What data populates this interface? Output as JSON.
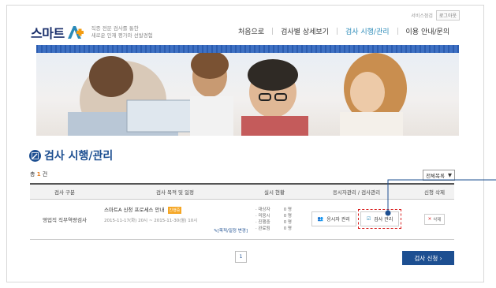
{
  "util": {
    "sitemap": "서비스점검",
    "logout": "로그아웃"
  },
  "logo": {
    "text": "스마트",
    "desc_line1": "직종 전문 검사를 통한",
    "desc_line2": "새로운 인재 평가와 선발경험"
  },
  "gnb": [
    {
      "label": "처음으로"
    },
    {
      "label": "검사별 상세보기"
    },
    {
      "label": "검사 시행/관리"
    },
    {
      "label": "이용 안내/문의"
    }
  ],
  "page": {
    "title": "검사 시행/관리",
    "total_prefix": "총",
    "total_count": "1",
    "total_suffix": "건",
    "filter": "전체목록"
  },
  "table": {
    "headers": [
      "검사 구분",
      "검사 목적 및 일정",
      "실시 현황",
      "응시자관리 / 검사관리",
      "신청 삭제"
    ],
    "row": {
      "category": "영업직 직무역량검사",
      "name": "스마트A 신청 프로세스 안내",
      "badge": "진행중",
      "period": "2015-11-17(화) 20시 ~ 2015-11-30(월) 10시",
      "edit": "[목적/일정 변경]",
      "status": [
        {
          "label": "· 대상자",
          "value": "0 명"
        },
        {
          "label": "· 미응시",
          "value": "0 명"
        },
        {
          "label": "· 진행중",
          "value": "0 명"
        },
        {
          "label": "· 완료됨",
          "value": "0 명"
        }
      ],
      "applicant_btn": "응시자 관리",
      "manage_btn": "검사 관리",
      "delete_btn": "삭제"
    }
  },
  "pager": {
    "page": "1"
  },
  "apply_btn": "검사 신청 ›",
  "colors": {
    "primary": "#1d4f91",
    "accent": "#2a8ab8",
    "highlight": "#d92020",
    "badge": "#f5a623"
  }
}
